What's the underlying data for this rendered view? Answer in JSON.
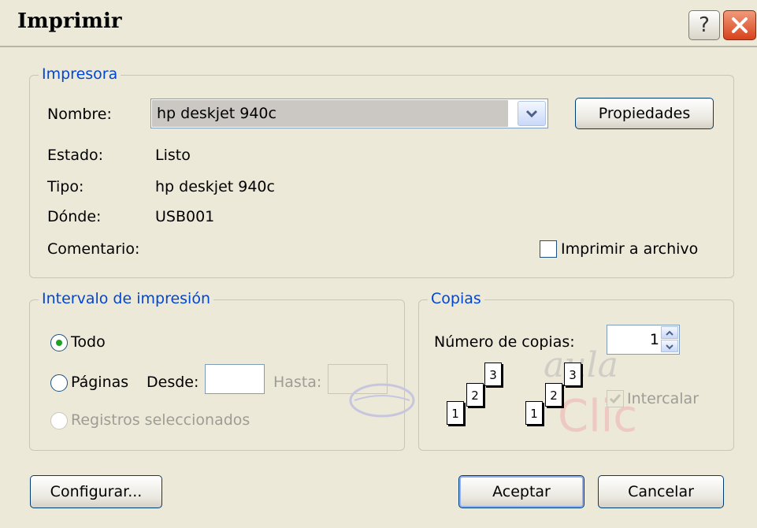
{
  "window": {
    "title": "Imprimir",
    "help_label": "?"
  },
  "printer": {
    "group_label": "Impresora",
    "name_label": "Nombre:",
    "name_value": "hp deskjet 940c",
    "properties_label": "Propiedades",
    "status_label": "Estado:",
    "status_value": "Listo",
    "type_label": "Tipo:",
    "type_value": "hp deskjet 940c",
    "where_label": "Dónde:",
    "where_value": "USB001",
    "comment_label": "Comentario:",
    "print_to_file_label": "Imprimir a archivo",
    "print_to_file_checked": false
  },
  "range": {
    "group_label": "Intervalo de impresión",
    "all_label": "Todo",
    "pages_label": "Páginas",
    "from_label": "Desde:",
    "to_label": "Hasta:",
    "selection_label": "Registros seleccionados",
    "selected_option": "Todo"
  },
  "copies": {
    "group_label": "Copias",
    "count_label": "Número de copias:",
    "count_value": "1",
    "collate_label": "Intercalar",
    "collate_checked": true,
    "collate_pages": [
      "1",
      "2",
      "3"
    ]
  },
  "watermark": {
    "text_top": "aula",
    "text_bottom": "Clic"
  },
  "footer": {
    "configure_label": "Configurar...",
    "ok_label": "Aceptar",
    "cancel_label": "Cancelar"
  }
}
